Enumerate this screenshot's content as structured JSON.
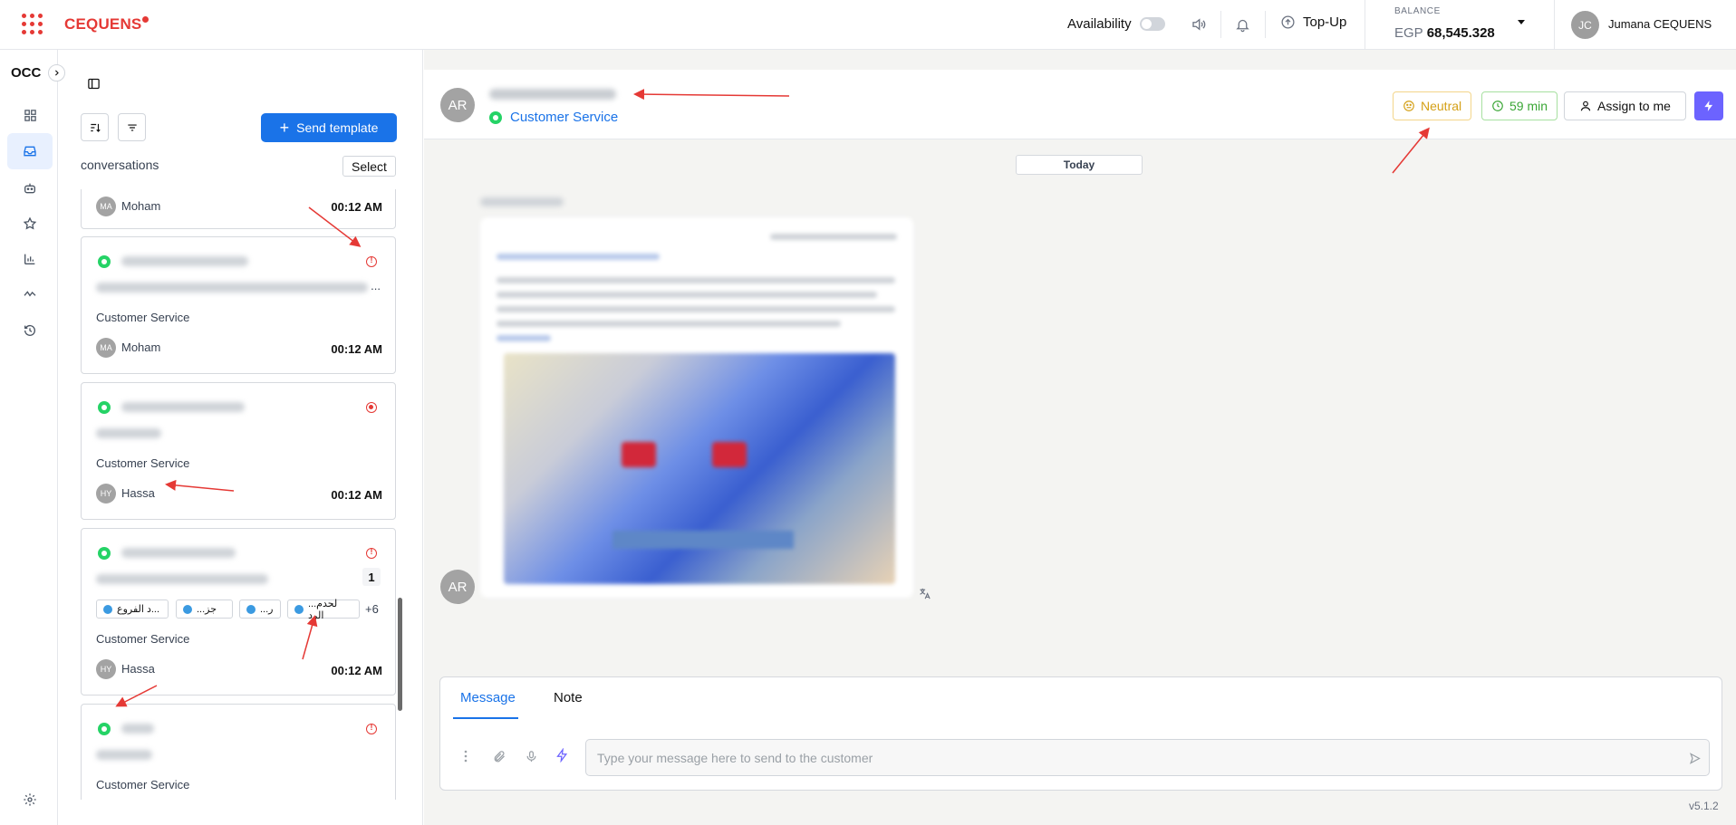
{
  "topbar": {
    "brand": "CEQUENS",
    "availability_label": "Availability",
    "topup_label": "Top-Up",
    "balance_label": "BALANCE",
    "balance_currency": "EGP",
    "balance_value": "68,545.328",
    "user_initials": "JC",
    "user_name": "Jumana CEQUENS"
  },
  "rail": {
    "title": "OCC",
    "items": [
      "dashboard-icon",
      "inbox-icon",
      "bot-icon",
      "star-icon",
      "chart-icon",
      "activity-icon",
      "history-icon",
      "settings-icon"
    ]
  },
  "conversations": {
    "send_template_label": "Send template",
    "title": "conversations",
    "select_label": "Select",
    "cards": [
      {
        "agent_initials": "MA",
        "agent": "Moham",
        "time": "00:12 AM"
      },
      {
        "team": "Customer Service",
        "agent_initials": "MA",
        "agent": "Moham",
        "time": "00:12 AM",
        "ellipsis": "..."
      },
      {
        "team": "Customer Service",
        "agent_initials": "HY",
        "agent": "Hassa",
        "time": "00:12 AM"
      },
      {
        "team": "Customer Service",
        "agent_initials": "HY",
        "agent": "Hassa",
        "time": "00:12 AM",
        "unread": "1",
        "tags": [
          "د الفروع...",
          "...جز",
          "...ر",
          "...لحدم الرد"
        ],
        "more_tags": "+6"
      },
      {
        "team": "Customer Service"
      }
    ]
  },
  "chat": {
    "contact_initials": "AR",
    "team": "Customer Service",
    "sentiment": "Neutral",
    "timer": "59 min",
    "assign_label": "Assign to me",
    "day_label": "Today",
    "composer": {
      "tab_message": "Message",
      "tab_note": "Note",
      "placeholder": "Type your message here to send to the customer"
    }
  },
  "footer": {
    "version": "v5.1.2"
  },
  "colors": {
    "brand_red": "#e53935",
    "primary_blue": "#1a73e8",
    "neutral_yellow": "#d4a017",
    "timer_green": "#3aa635",
    "bolt_purple": "#6c63ff",
    "whatsapp_green": "#25d366"
  }
}
